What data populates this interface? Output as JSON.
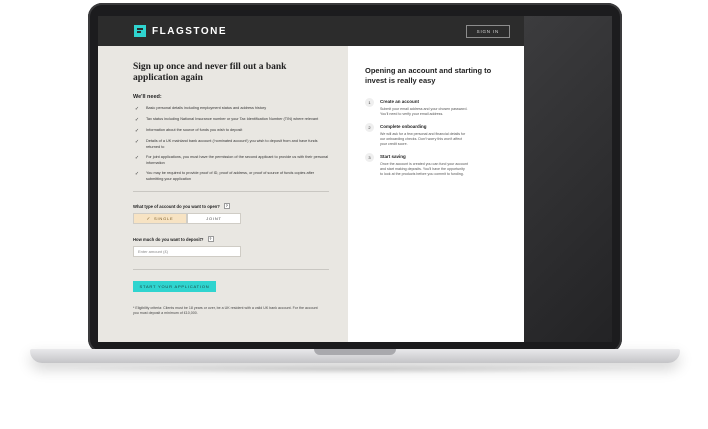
{
  "header": {
    "brand": "FLAGSTONE",
    "sign_in": "SIGN IN"
  },
  "form": {
    "title": "Sign up once and never fill out a bank application again",
    "need_heading": "We'll need:",
    "needs": [
      "Basic personal details including employment status and address history",
      "Tax status including National Insurance number or your Tax Identification Number (TIN) where relevant",
      "Information about the source of funds you wish to deposit",
      "Details of a UK mainland bank account ('nominated account') you wish to deposit from and have funds returned to",
      "For joint applications, you must have the permission of the second applicant to provide us with their personal information",
      "You may be required to provide proof of ID, proof of address, or proof of source of funds copies after submitting your application"
    ],
    "account_type_label": "What type of account do you want to open?",
    "help": "?",
    "option_single": "SINGLE",
    "option_joint": "JOINT",
    "deposit_label": "How much do you want to deposit?",
    "amount_placeholder": "Enter amount (£)",
    "start_button": "START YOUR APPLICATION",
    "eligibility": "* Eligibility criteria: Clients must be 18 years or over, be a UK resident with a valid UK bank account. For the account you must deposit a minimum of £10,000."
  },
  "info": {
    "title": "Opening an account and starting to invest is really easy",
    "steps": [
      {
        "num": "1",
        "title": "Create an account",
        "desc": "Submit your email address and your chosen password. You'll need to verify your email address."
      },
      {
        "num": "2",
        "title": "Complete onboarding",
        "desc": "We will ask for a few personal and financial details for our onboarding checks. Don't worry this won't affect your credit score."
      },
      {
        "num": "3",
        "title": "Start saving",
        "desc": "Once the account is created you can fund your account and start making deposits. You'll have the opportunity to look at the products before you commit to funding."
      }
    ]
  },
  "colors": {
    "accent": "#2fd4cf",
    "header_bg": "#2c2c2c",
    "panel_bg": "#e9e7e2",
    "selected_option": "#f7e3c3"
  }
}
